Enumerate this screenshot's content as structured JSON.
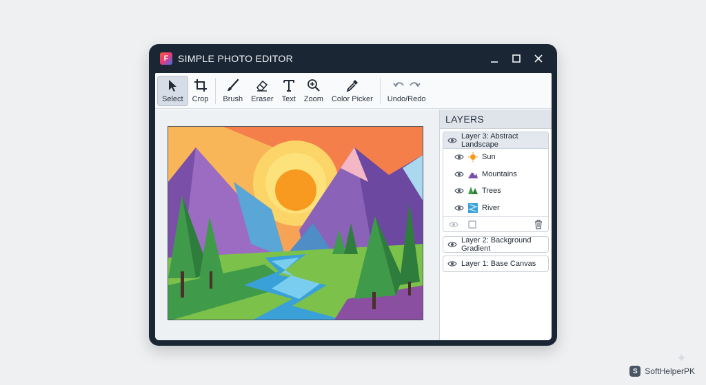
{
  "window": {
    "title": "SIMPLE PHOTO EDITOR",
    "app_logo_letter": "F",
    "controls": [
      "minimize",
      "maximize",
      "close"
    ]
  },
  "toolbar": {
    "tools": [
      {
        "id": "select",
        "label": "Select",
        "icon": "cursor-arrow-icon",
        "active": true
      },
      {
        "id": "crop",
        "label": "Crop",
        "icon": "crop-icon"
      },
      {
        "id": "brush",
        "label": "Brush",
        "icon": "brush-icon"
      },
      {
        "id": "eraser",
        "label": "Eraser",
        "icon": "eraser-icon"
      },
      {
        "id": "text",
        "label": "Text",
        "icon": "text-t-icon"
      },
      {
        "id": "zoom",
        "label": "Zoom",
        "icon": "magnifier-icon"
      },
      {
        "id": "color_picker",
        "label": "Color Picker",
        "icon": "eyedropper-icon"
      },
      {
        "id": "undo_redo",
        "label": "Undo/Redo",
        "icon": "undo-redo-icon"
      }
    ]
  },
  "layers": {
    "header": "LAYERS",
    "group": {
      "label": "Layer 3: Abstract Landscape",
      "selected": true,
      "children": [
        {
          "label": "Sun",
          "icon": "sun-icon"
        },
        {
          "label": "Mountains",
          "icon": "mountain-icon"
        },
        {
          "label": "Trees",
          "icon": "tree-icon"
        },
        {
          "label": "River",
          "icon": "river-icon"
        }
      ]
    },
    "others": [
      {
        "label": "Layer 2: Background Gradient"
      },
      {
        "label": "Layer 1: Base Canvas"
      }
    ]
  },
  "watermark": {
    "text": "SoftHelperPK",
    "logo_letter": "S"
  },
  "colors": {
    "window_frame": "#1b2634",
    "accent_selected": "#d7dde6",
    "sky_top": "#f6b054",
    "sun": "#f79a1f",
    "mountain_purple": "#7a4fa8",
    "grass": "#7cc24a",
    "river": "#3aa0d8"
  }
}
